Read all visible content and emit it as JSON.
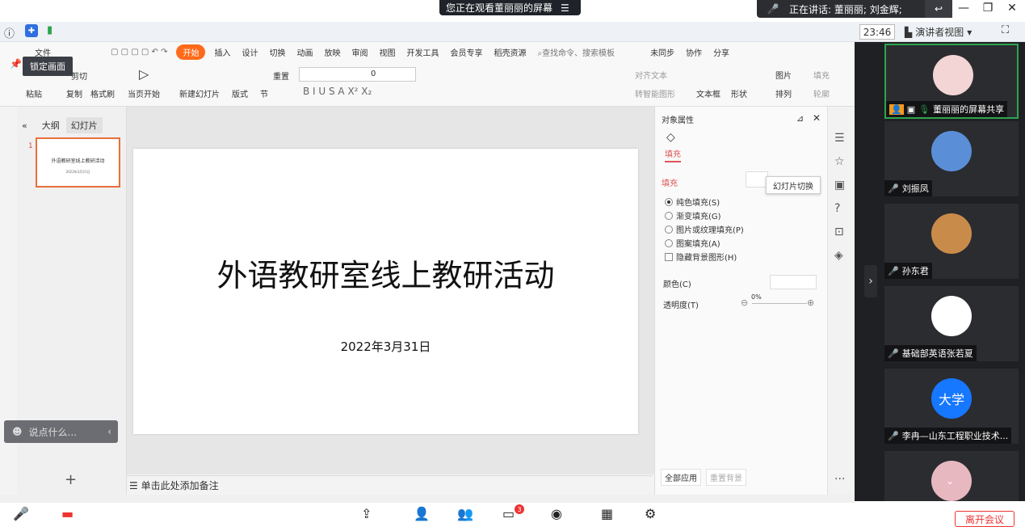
{
  "meeting": {
    "viewing_text": "您正在观看董丽丽的屏幕",
    "speaking_text": "正在讲话: 董丽丽; 刘金辉;",
    "time": "23:46",
    "presenter_view": "演讲者视图",
    "leave_label": "离开会议",
    "chat_placeholder": "说点什么...",
    "chat_badge": "3"
  },
  "wps": {
    "lock_label": "锁定画面",
    "menu": [
      "文件",
      "开始",
      "插入",
      "设计",
      "切换",
      "动画",
      "放映",
      "审阅",
      "视图",
      "开发工具",
      "会员专享",
      "稻壳资源"
    ],
    "search_placeholder": "查找命令、搜索模板",
    "sync": "未同步",
    "collab": "协作",
    "share": "分享",
    "ribbon": {
      "paste": "粘贴",
      "cut": "剪切",
      "copy": "复制",
      "format_painter": "格式刷",
      "from_current": "当页开始",
      "new_slide": "新建幻灯片",
      "layout": "版式",
      "section": "节",
      "reset": "重置",
      "font_size": "0",
      "align_text": "对齐文本",
      "smart_shape": "转智能图形",
      "textbox": "文本框",
      "shape": "形状",
      "picture": "图片",
      "fill": "填充",
      "arrange": "排列",
      "outline": "轮廓"
    },
    "left_tabs": {
      "outline": "大纲",
      "slides": "幻灯片"
    },
    "thumb_number": "1",
    "thumb_title": "外语教研室线上教研活动",
    "thumb_date": "2022年3月31日",
    "slide": {
      "title": "外语教研室线上教研活动",
      "date": "2022年3月31日"
    },
    "notes_placeholder": "单击此处添加备注",
    "properties": {
      "header": "对象属性",
      "fill_tab": "填充",
      "fill_section": "填充",
      "options": [
        "纯色填充(S)",
        "渐变填充(G)",
        "图片或纹理填充(P)",
        "图案填充(A)"
      ],
      "checkbox": "隐藏背景图形(H)",
      "color_label": "颜色(C)",
      "transparency_label": "透明度(T)",
      "transparency_value": "0%",
      "apply_all": "全部应用",
      "reset_bg": "重置背景"
    },
    "tooltip": "幻灯片切换"
  },
  "participants": [
    {
      "name": "董丽丽的屏幕共享",
      "avatar_color": "#f3d5d5"
    },
    {
      "name": "刘振凤",
      "avatar_color": "#5a8fd8"
    },
    {
      "name": "孙东君",
      "avatar_color": "#c98b4a"
    },
    {
      "name": "基础部英语张若夏",
      "avatar_color": "#ffffff"
    },
    {
      "name": "李冉—山东工程职业技术...",
      "avatar_text": "大学",
      "avatar_color": "#1677ff"
    },
    {
      "name": "",
      "avatar_color": "#e8b8c0"
    }
  ]
}
